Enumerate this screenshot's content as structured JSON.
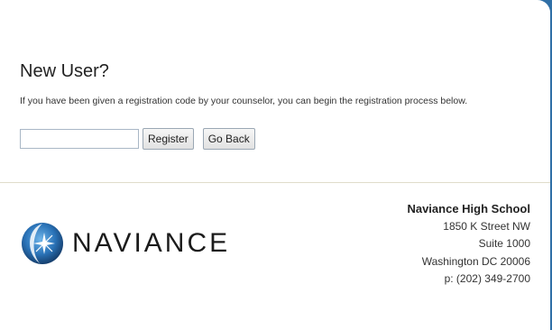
{
  "registration": {
    "title": "New User?",
    "description": "If you have been given a registration code by your counselor, you can begin the registration process below.",
    "code_input_value": "",
    "code_input_placeholder": "",
    "register_label": "Register",
    "go_back_label": "Go Back"
  },
  "footer": {
    "brand_name": "NAVIANCE",
    "logo_icon": "naviance-star-globe-icon",
    "school_name": "Naviance High School",
    "address_line1": "1850 K Street NW",
    "address_line2": "Suite 1000",
    "address_line3": "Washington DC 20006",
    "phone": "p: (202) 349-2700"
  },
  "colors": {
    "frame": "#2f6fa6",
    "panel": "#ffffff",
    "divider": "#e0dccb",
    "logo_blue": "#1f5d9c"
  }
}
